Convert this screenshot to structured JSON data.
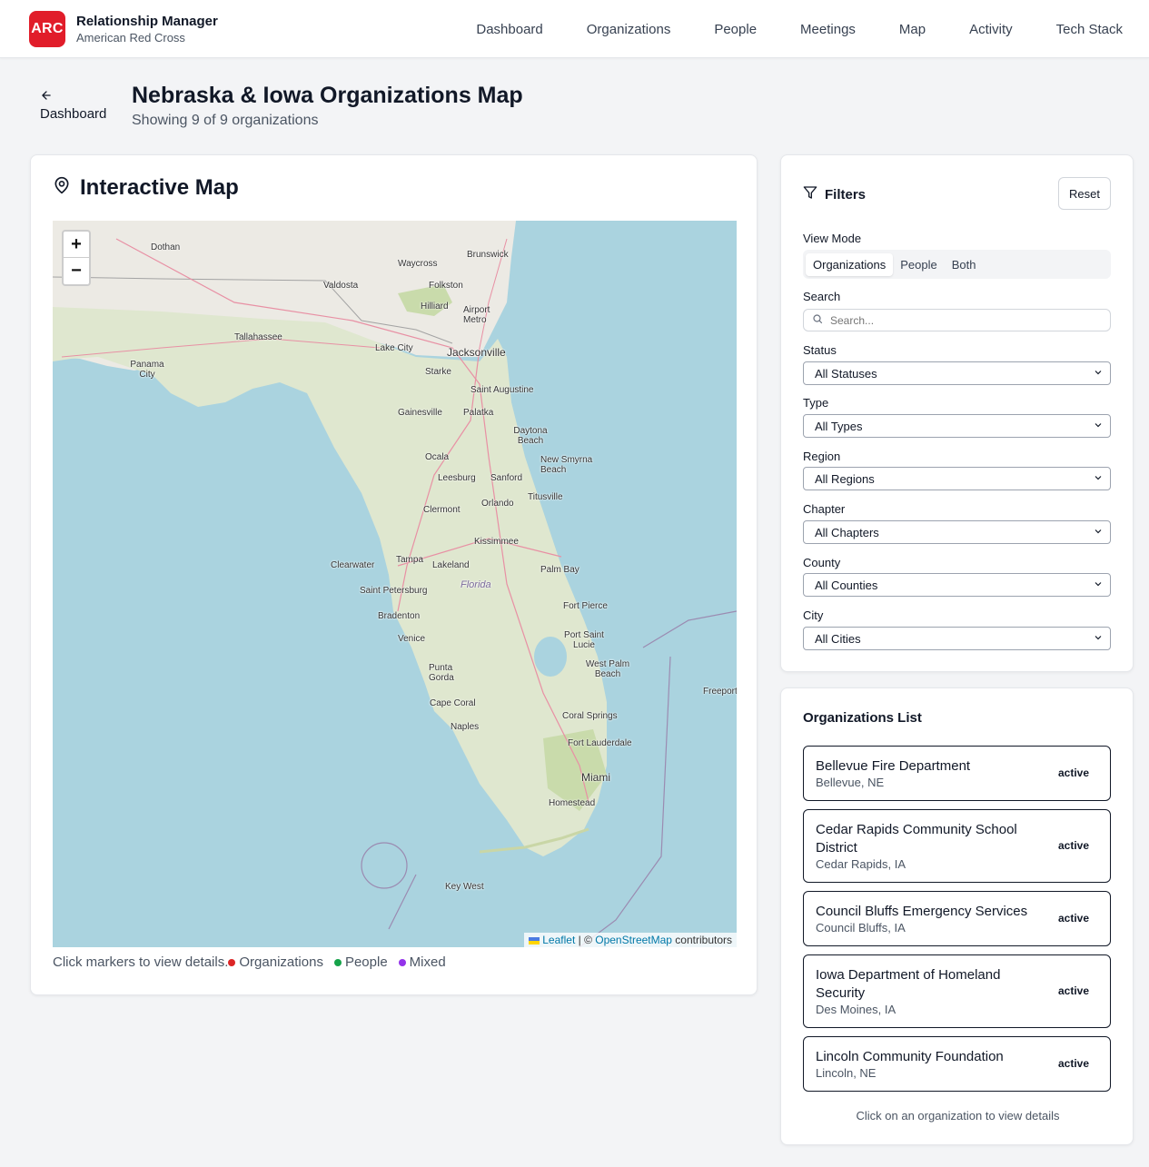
{
  "header": {
    "logo": "ARC",
    "app_title": "Relationship Manager",
    "org_name": "American Red Cross",
    "nav": [
      "Dashboard",
      "Organizations",
      "People",
      "Meetings",
      "Map",
      "Activity",
      "Tech Stack"
    ]
  },
  "page": {
    "back_label": "Dashboard",
    "title": "Nebraska & Iowa Organizations Map",
    "subtitle": "Showing 9 of 9 organizations"
  },
  "map_card": {
    "title": "Interactive Map",
    "zoom_in": "+",
    "zoom_out": "−",
    "attribution": {
      "leaflet": "Leaflet",
      "sep": " | © ",
      "osm": "OpenStreetMap",
      "suffix": " contributors"
    },
    "legend_hint": "Click markers to view details.",
    "legend": [
      {
        "label": "Organizations",
        "color": "#dc2626"
      },
      {
        "label": "People",
        "color": "#16a34a"
      },
      {
        "label": "Mixed",
        "color": "#9333ea"
      }
    ],
    "place_labels": [
      "Dothan",
      "Waycross",
      "Brunswick",
      "Valdosta",
      "Folkston",
      "Hilliard",
      "Airport Metro",
      "Tallahassee",
      "Lake City",
      "Jacksonville",
      "Panama City",
      "Starke",
      "Saint Augustine",
      "Gainesville",
      "Palatka",
      "Daytona Beach",
      "Ocala",
      "New Smyrna Beach",
      "Leesburg",
      "Sanford",
      "Titusville",
      "Orlando",
      "Clermont",
      "Kissimmee",
      "Clearwater",
      "Tampa",
      "Lakeland",
      "Palm Bay",
      "Florida",
      "Saint Petersburg",
      "Fort Pierce",
      "Bradenton",
      "Port Saint Lucie",
      "Venice",
      "West Palm Beach",
      "Punta Gorda",
      "Freeport",
      "Cape Coral",
      "Coral Springs",
      "Naples",
      "Fort Lauderdale",
      "Miami",
      "Homestead",
      "Key West"
    ]
  },
  "filters": {
    "title": "Filters",
    "reset": "Reset",
    "view_mode_label": "View Mode",
    "view_modes": [
      "Organizations",
      "People",
      "Both"
    ],
    "search_label": "Search",
    "search_placeholder": "Search...",
    "status_label": "Status",
    "status_value": "All Statuses",
    "type_label": "Type",
    "type_value": "All Types",
    "region_label": "Region",
    "region_value": "All Regions",
    "chapter_label": "Chapter",
    "chapter_value": "All Chapters",
    "county_label": "County",
    "county_value": "All Counties",
    "city_label": "City",
    "city_value": "All Cities"
  },
  "org_list": {
    "title": "Organizations List",
    "items": [
      {
        "name": "Bellevue Fire Department",
        "city": "Bellevue, NE",
        "status": "active"
      },
      {
        "name": "Cedar Rapids Community School District",
        "city": "Cedar Rapids, IA",
        "status": "active"
      },
      {
        "name": "Council Bluffs Emergency Services",
        "city": "Council Bluffs, IA",
        "status": "active"
      },
      {
        "name": "Iowa Department of Homeland Security",
        "city": "Des Moines, IA",
        "status": "active"
      },
      {
        "name": "Lincoln Community Foundation",
        "city": "Lincoln, NE",
        "status": "active"
      }
    ],
    "footer": "Click on an organization to view details"
  }
}
